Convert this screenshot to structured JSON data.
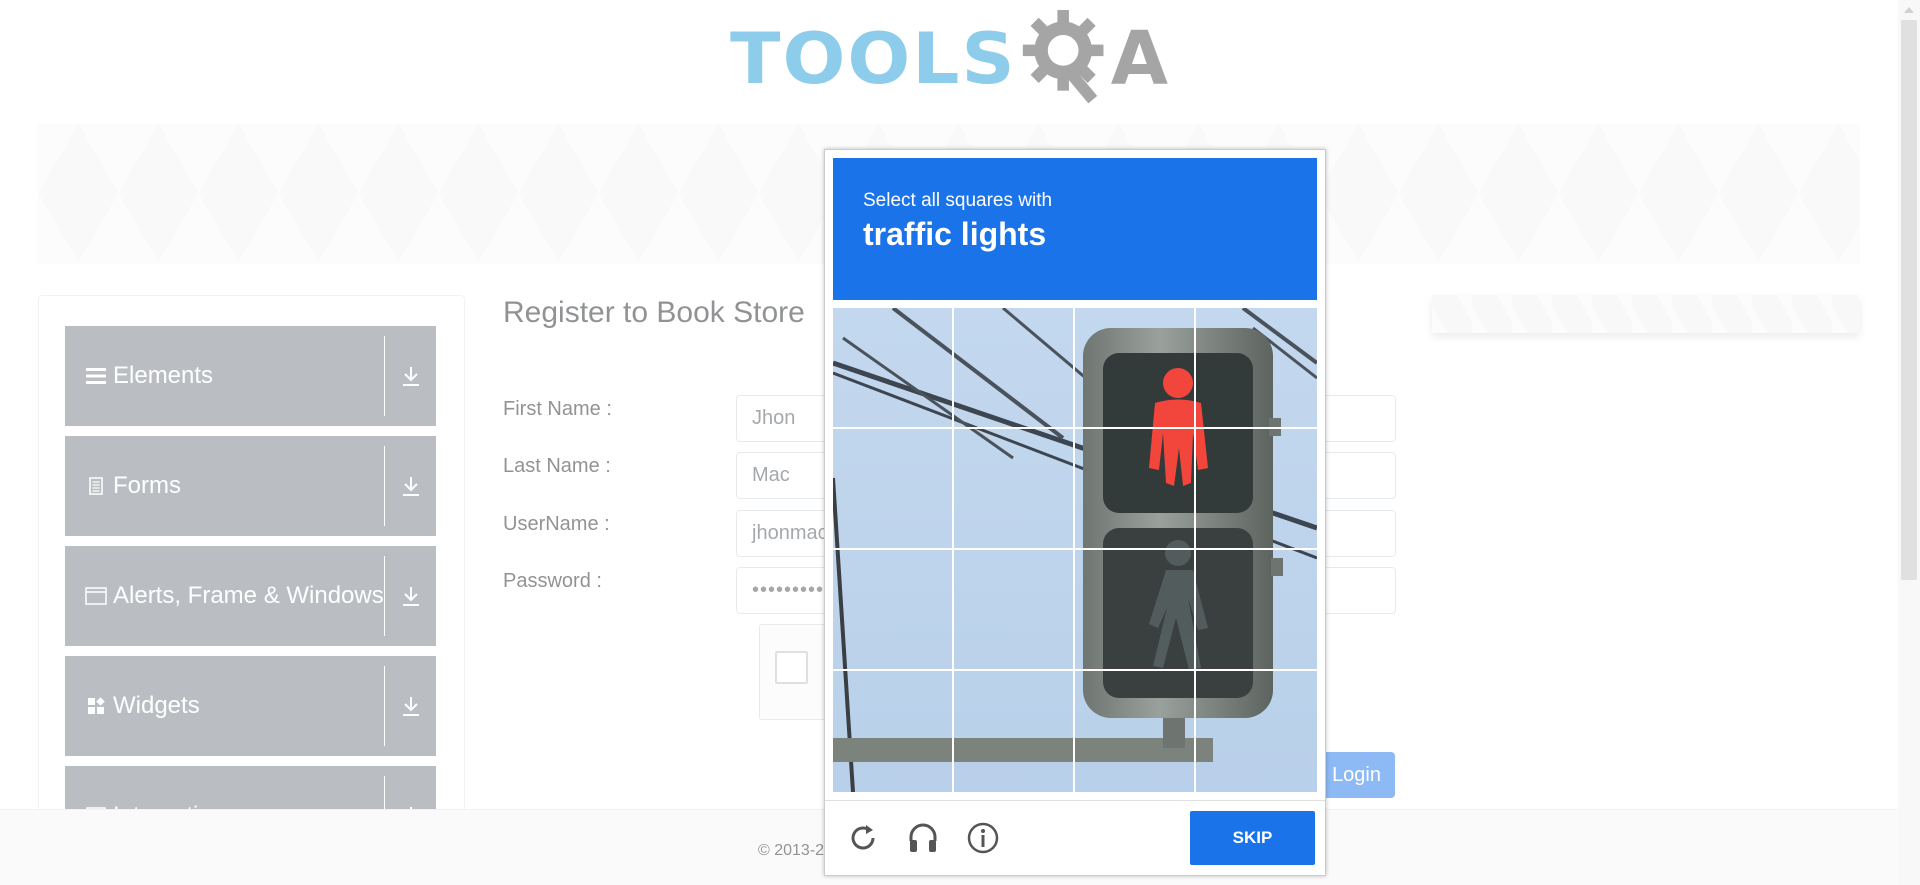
{
  "header": {
    "logo_text": "TOOLS",
    "logo_suffix": "A"
  },
  "sidebar": {
    "groups": [
      {
        "label": "Elements",
        "icon": "hamburger-icon"
      },
      {
        "label": "Forms",
        "icon": "document-icon"
      },
      {
        "label": "Alerts, Frame & Windows",
        "icon": "window-icon"
      },
      {
        "label": "Widgets",
        "icon": "widgets-icon"
      },
      {
        "label": "Interactions",
        "icon": "interactions-icon"
      }
    ]
  },
  "form": {
    "title": "Register to Book Store",
    "first_name_label": "First Name :",
    "first_name_value": "Jhon",
    "last_name_label": "Last Name :",
    "last_name_value": "Mac",
    "username_label": "UserName :",
    "username_value": "jhonmac",
    "password_label": "Password :",
    "password_value": "•••••••••",
    "login_label": "Login"
  },
  "footer": {
    "text": "© 2013-2"
  },
  "captcha": {
    "instruction": "Select all squares with",
    "target": "traffic lights",
    "skip_label": "SKIP",
    "icons": [
      "reload-icon",
      "audio-icon",
      "info-icon"
    ],
    "accent_color": "#1a73e8"
  }
}
